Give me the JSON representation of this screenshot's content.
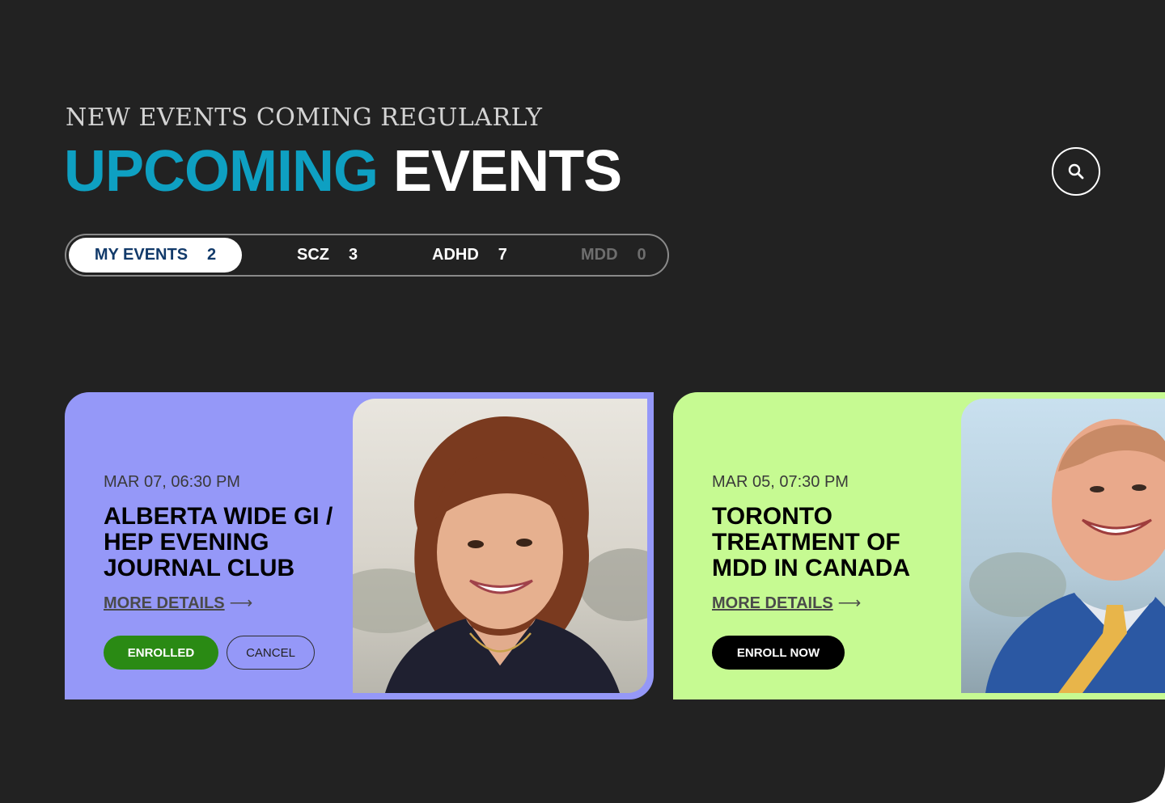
{
  "header": {
    "eyebrow": "NEW EVENTS COMING REGULARLY",
    "title_accent": "UPCOMING",
    "title_plain": "EVENTS",
    "accent_color": "#0ea0c2"
  },
  "search": {
    "icon": "search-icon"
  },
  "tabs": [
    {
      "label": "MY EVENTS",
      "count": "2",
      "active": true
    },
    {
      "label": "SCZ",
      "count": "3",
      "active": false
    },
    {
      "label": "ADHD",
      "count": "7",
      "active": false
    },
    {
      "label": "MDD",
      "count": "0",
      "active": false,
      "disabled": true
    }
  ],
  "events": [
    {
      "date": "MAR 07, 06:30 PM",
      "title": "ALBERTA WIDE GI / HEP EVENING JOURNAL CLUB",
      "more_label": "MORE DETAILS",
      "arrow": "⟶",
      "status_label": "ENROLLED",
      "cancel_label": "CANCEL",
      "bg_color": "#9598f8"
    },
    {
      "date": "MAR 05, 07:30 PM",
      "title": "TORONTO TREATMENT OF MDD IN CANADA",
      "more_label": "MORE DETAILS",
      "arrow": "⟶",
      "enroll_label": "ENROLL NOW",
      "bg_color": "#c6fa92"
    }
  ]
}
